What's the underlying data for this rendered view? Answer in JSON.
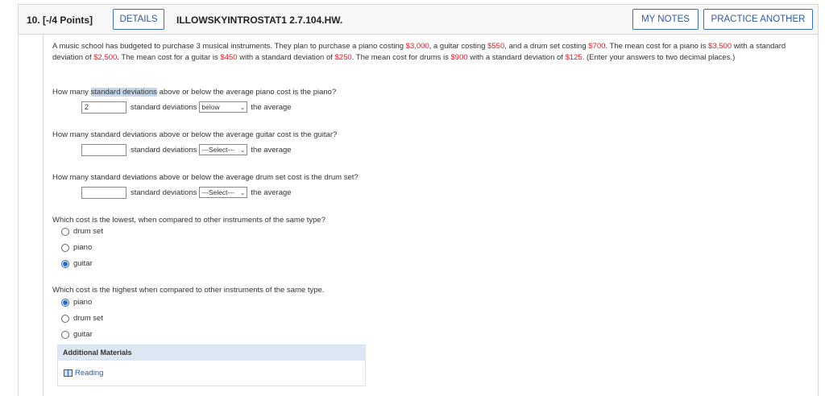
{
  "header": {
    "question_number": "10. [-/4 Points]",
    "details_label": "DETAILS",
    "assignment_id": "ILLOWSKYINTROSTAT1 2.7.104.HW.",
    "my_notes_label": "MY NOTES",
    "practice_label": "PRACTICE ANOTHER"
  },
  "problem": {
    "t1": "A music school has budgeted to purchase 3 musical instruments. They plan to purchase a piano costing ",
    "v1": "$3,000",
    "t2": ", a guitar costing ",
    "v2": "$550",
    "t3": ", and a drum set costing ",
    "v3": "$700",
    "t4": ". The mean cost for a piano is ",
    "v4": "$3,500",
    "t5": " with a standard deviation of ",
    "v5": "$2,500",
    "t6": ". The mean cost for a guitar is ",
    "v6": "$450",
    "t7": " with a standard deviation of ",
    "v7": "$250",
    "t8": ". The mean cost for drums is ",
    "v8": "$900",
    "t9": " with a standard deviation of ",
    "v9": "$125",
    "t10": ". (Enter your answers to two decimal places.)"
  },
  "q1": {
    "prefix": "How many ",
    "highlight": "standard deviations",
    "suffix": " above or below the average piano cost is the piano?",
    "value": "2",
    "label": "standard deviations",
    "select": "below",
    "tail": "the average"
  },
  "q2": {
    "text": "How many standard deviations above or below the average guitar cost is the guitar?",
    "value": "",
    "label": "standard deviations",
    "select": "---Select---",
    "tail": "the average"
  },
  "q3": {
    "text": "How many standard deviations above or below the average drum set cost is the drum set?",
    "value": "",
    "label": "standard deviations",
    "select": "---Select---",
    "tail": "the average"
  },
  "q4": {
    "text": "Which cost is the lowest, when compared to other instruments of the same type?",
    "options": [
      "drum set",
      "piano",
      "guitar"
    ],
    "selected": "guitar"
  },
  "q5": {
    "text": "Which cost is the highest when compared to other instruments of the same type.",
    "options": [
      "piano",
      "drum set",
      "guitar"
    ],
    "selected": "piano"
  },
  "additional": {
    "title": "Additional Materials",
    "reading_label": "Reading"
  },
  "colors": {
    "accent": "#2c5aa0",
    "value_red": "#d2232a",
    "radio_blue": "#2a66c8"
  }
}
